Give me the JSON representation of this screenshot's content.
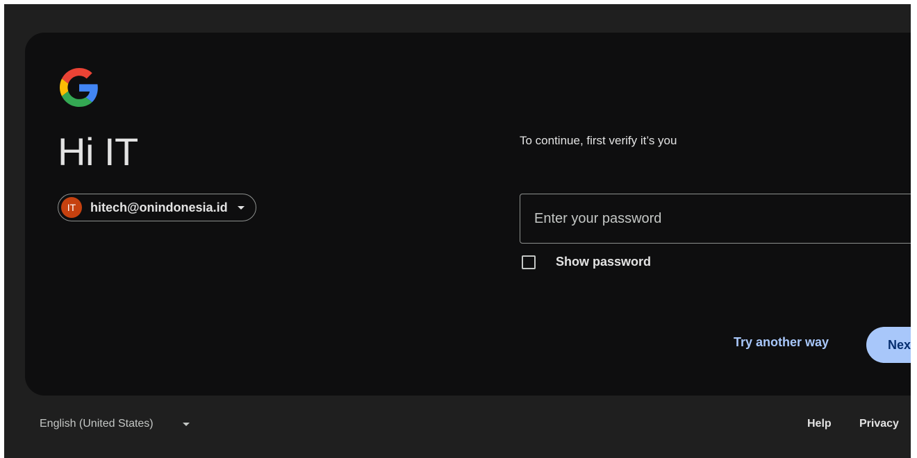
{
  "brand": {
    "logo_icon": "google-g-logo-icon",
    "colors": {
      "blue": "#4285F4",
      "red": "#EA4335",
      "yellow": "#FBBC05",
      "green": "#34A853"
    }
  },
  "greeting": "Hi IT",
  "account": {
    "avatar_initials": "IT",
    "avatar_color": "#c5410f",
    "email": "hitech@onindonesia.id",
    "caret_icon": "caret-down-icon"
  },
  "verify": {
    "prompt": "To continue, first verify it’s you",
    "password_placeholder": "Enter your password",
    "password_value": "",
    "show_password_label": "Show password",
    "show_password_checked": false
  },
  "actions": {
    "try_another_label": "Try another way",
    "next_label": "Nex"
  },
  "footer": {
    "language": "English (United States)",
    "help_label": "Help",
    "privacy_label": "Privacy"
  },
  "theme": {
    "background": "#1f1f1f",
    "card": "#0e0e0f",
    "accent": "#a8c7fa",
    "text": "#e3e3e3"
  }
}
